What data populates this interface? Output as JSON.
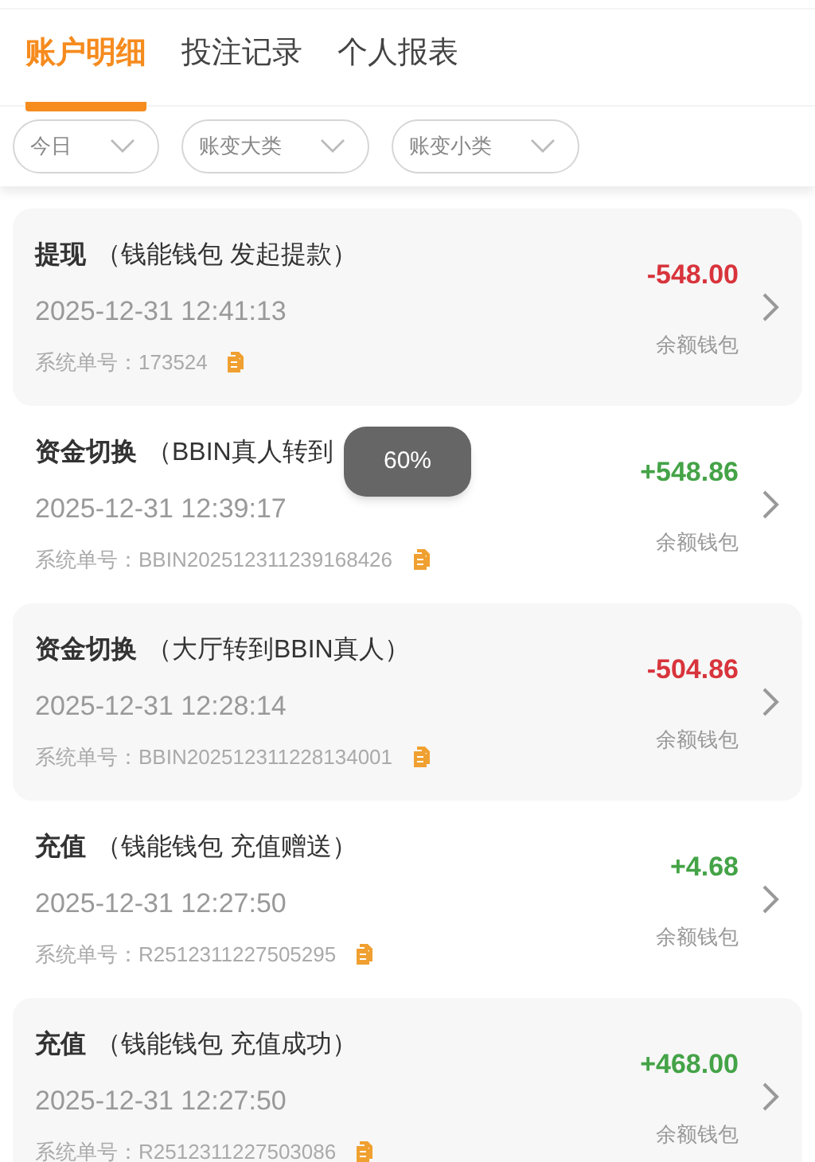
{
  "tabs": [
    {
      "label": "账户明细",
      "selected": true
    },
    {
      "label": "投注记录",
      "selected": false
    },
    {
      "label": "个人报表",
      "selected": false
    }
  ],
  "filters": [
    {
      "label": "今日"
    },
    {
      "label": "账变大类"
    },
    {
      "label": "账变小类"
    }
  ],
  "records": [
    {
      "type": "提现",
      "detail": "（钱能钱包 发起提款）",
      "time": "2025-12-31 12:41:13",
      "order_label": "系统单号：",
      "order_no": "173524",
      "amount": "-548.00",
      "color": "#d8343c",
      "wallet": "余额钱包"
    },
    {
      "type": "资金切换",
      "detail": "（BBIN真人转到",
      "time": "2025-12-31 12:39:17",
      "order_label": "系统单号：",
      "order_no": "BBIN202512311239168426",
      "amount": "+548.86",
      "color": "#44a347",
      "wallet": "余额钱包"
    },
    {
      "type": "资金切换",
      "detail": "（大厅转到BBIN真人）",
      "time": "2025-12-31 12:28:14",
      "order_label": "系统单号：",
      "order_no": "BBIN202512311228134001",
      "amount": "-504.86",
      "color": "#d8343c",
      "wallet": "余额钱包"
    },
    {
      "type": "充值",
      "detail": "（钱能钱包 充值赠送）",
      "time": "2025-12-31 12:27:50",
      "order_label": "系统单号：",
      "order_no": "R2512311227505295",
      "amount": "+4.68",
      "color": "#44a347",
      "wallet": "余额钱包"
    },
    {
      "type": "充值",
      "detail": "（钱能钱包 充值成功）",
      "time": "2025-12-31 12:27:50",
      "order_label": "系统单号：",
      "order_no": "R2512311227503086",
      "amount": "+468.00",
      "color": "#44a347",
      "wallet": "余额钱包"
    }
  ],
  "toast": {
    "text": "60%"
  }
}
